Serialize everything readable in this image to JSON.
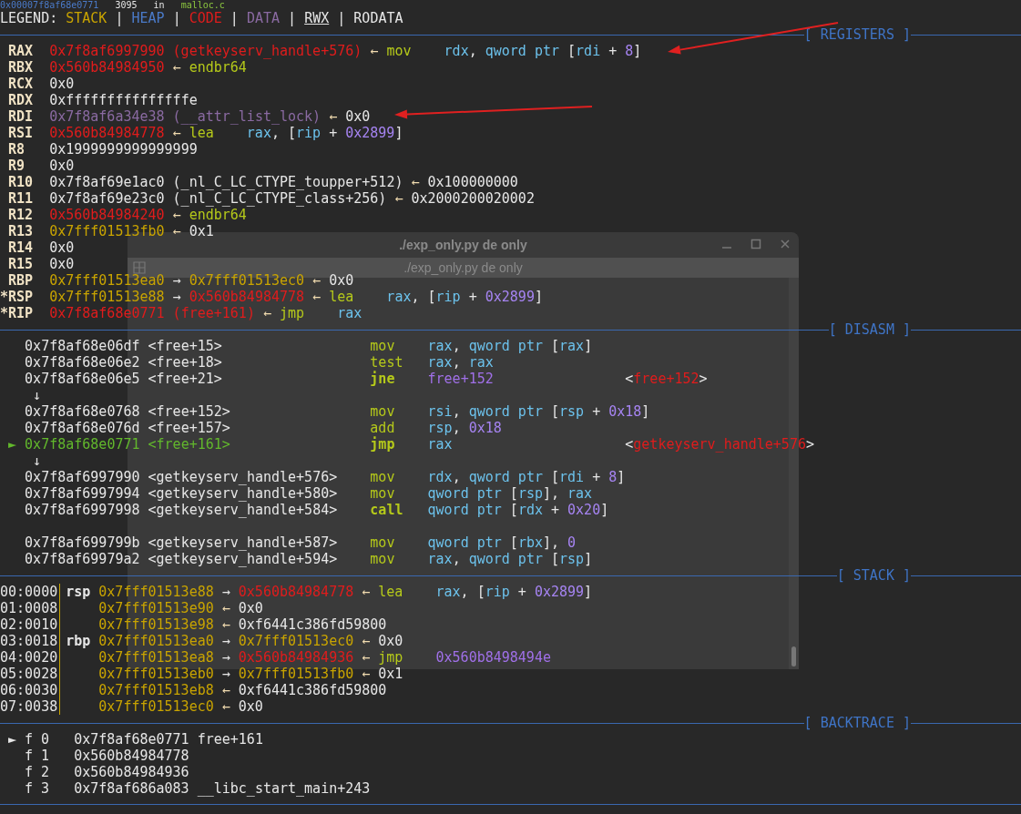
{
  "location_line": [
    {
      "text": "0x00007f8af68e0771",
      "kind": "heap"
    },
    {
      "text": "3095",
      "kind": "plain"
    },
    {
      "text": "in",
      "kind": "plain"
    },
    {
      "text": "malloc.c",
      "kind": "file"
    }
  ],
  "legend": [
    {
      "text": "LEGEND: ",
      "kind": "plain"
    },
    {
      "text": "STACK",
      "kind": "stack"
    },
    {
      "text": " | ",
      "kind": "plain"
    },
    {
      "text": "HEAP",
      "kind": "heap"
    },
    {
      "text": " | ",
      "kind": "plain"
    },
    {
      "text": "CODE",
      "kind": "code"
    },
    {
      "text": " | ",
      "kind": "plain"
    },
    {
      "text": "DATA",
      "kind": "data"
    },
    {
      "text": " | ",
      "kind": "plain"
    },
    {
      "text": "RWX",
      "kind": "rwx"
    },
    {
      "text": " | ",
      "kind": "plain"
    },
    {
      "text": "RODATA",
      "kind": "plain"
    }
  ],
  "sections": [
    {
      "kind": "registers",
      "title": "[ REGISTERS ]",
      "rows": [
        {
          "name": "RAX",
          "changed": false,
          "cells": [
            {
              "text": "0x7f8af6997990",
              "kind": "code"
            },
            {
              "text": "(getkeyserv_handle+576)",
              "kind": "code"
            },
            {
              "text": "←",
              "kind": "arrow"
            },
            {
              "mnemonic": "mov",
              "operand": [
                {
                  "text": "rdx",
                  "kind": "reg"
                },
                {
                  "text": ", ",
                  "kind": "plain"
                },
                {
                  "text": "qword ptr ",
                  "kind": "reg"
                },
                {
                  "text": "[",
                  "kind": "plain"
                },
                {
                  "text": "rdi",
                  "kind": "reg"
                },
                {
                  "text": " + ",
                  "kind": "plain"
                },
                {
                  "text": "8",
                  "kind": "num"
                },
                {
                  "text": "]",
                  "kind": "plain"
                }
              ]
            }
          ]
        },
        {
          "name": "RBX",
          "changed": false,
          "cells": [
            {
              "text": "0x560b84984950",
              "kind": "code"
            },
            {
              "text": "←",
              "kind": "arrow"
            },
            {
              "mnemonic": "endbr64"
            }
          ]
        },
        {
          "name": "RCX",
          "changed": false,
          "cells": [
            {
              "text": "0x0",
              "kind": "plain"
            }
          ]
        },
        {
          "name": "RDX",
          "changed": false,
          "cells": [
            {
              "text": "0xfffffffffffffffe",
              "kind": "plain"
            }
          ]
        },
        {
          "name": "RDI",
          "changed": false,
          "cells": [
            {
              "text": "0x7f8af6a34e38",
              "kind": "data"
            },
            {
              "text": "(__attr_list_lock)",
              "kind": "data"
            },
            {
              "text": "←",
              "kind": "arrow"
            },
            {
              "text": "0x0",
              "kind": "plain"
            }
          ]
        },
        {
          "name": "RSI",
          "changed": false,
          "cells": [
            {
              "text": "0x560b84984778",
              "kind": "code"
            },
            {
              "text": "←",
              "kind": "arrow"
            },
            {
              "mnemonic": "lea",
              "operand": [
                {
                  "text": "rax",
                  "kind": "reg"
                },
                {
                  "text": ", [",
                  "kind": "plain"
                },
                {
                  "text": "rip",
                  "kind": "reg"
                },
                {
                  "text": " + ",
                  "kind": "plain"
                },
                {
                  "text": "0x2899",
                  "kind": "num"
                },
                {
                  "text": "]",
                  "kind": "plain"
                }
              ]
            }
          ]
        },
        {
          "name": "R8",
          "changed": false,
          "cells": [
            {
              "text": "0x1999999999999999",
              "kind": "plain"
            }
          ]
        },
        {
          "name": "R9",
          "changed": false,
          "cells": [
            {
              "text": "0x0",
              "kind": "plain"
            }
          ]
        },
        {
          "name": "R10",
          "changed": false,
          "cells": [
            {
              "text": "0x7f8af69e1ac0",
              "kind": "plain"
            },
            {
              "text": "(_nl_C_LC_CTYPE_toupper+512)",
              "kind": "plain"
            },
            {
              "text": "←",
              "kind": "arrow"
            },
            {
              "text": "0x100000000",
              "kind": "plain"
            }
          ]
        },
        {
          "name": "R11",
          "changed": false,
          "cells": [
            {
              "text": "0x7f8af69e23c0",
              "kind": "plain"
            },
            {
              "text": "(_nl_C_LC_CTYPE_class+256)",
              "kind": "plain"
            },
            {
              "text": "←",
              "kind": "arrow"
            },
            {
              "text": "0x2000200020002",
              "kind": "plain"
            }
          ]
        },
        {
          "name": "R12",
          "changed": false,
          "cells": [
            {
              "text": "0x560b84984240",
              "kind": "code"
            },
            {
              "text": "←",
              "kind": "arrow"
            },
            {
              "mnemonic": "endbr64"
            }
          ]
        },
        {
          "name": "R13",
          "changed": false,
          "cells": [
            {
              "text": "0x7fff01513fb0",
              "kind": "stack"
            },
            {
              "text": "←",
              "kind": "arrow"
            },
            {
              "text": "0x1",
              "kind": "plain"
            }
          ]
        },
        {
          "name": "R14",
          "changed": false,
          "cells": [
            {
              "text": "0x0",
              "kind": "plain"
            }
          ]
        },
        {
          "name": "R15",
          "changed": false,
          "cells": [
            {
              "text": "0x0",
              "kind": "plain"
            }
          ]
        },
        {
          "name": "RBP",
          "changed": false,
          "cells": [
            {
              "text": "0x7fff01513ea0",
              "kind": "stack"
            },
            {
              "text": "→",
              "kind": "plain"
            },
            {
              "text": "0x7fff01513ec0",
              "kind": "stack"
            },
            {
              "text": "←",
              "kind": "arrow"
            },
            {
              "text": "0x0",
              "kind": "plain"
            }
          ]
        },
        {
          "name": "*RSP",
          "changed": true,
          "cells": [
            {
              "text": "0x7fff01513e88",
              "kind": "stack"
            },
            {
              "text": "→",
              "kind": "plain"
            },
            {
              "text": "0x560b84984778",
              "kind": "code"
            },
            {
              "text": "←",
              "kind": "arrow"
            },
            {
              "mnemonic": "lea",
              "operand": [
                {
                  "text": "rax",
                  "kind": "reg"
                },
                {
                  "text": ", [",
                  "kind": "plain"
                },
                {
                  "text": "rip",
                  "kind": "reg"
                },
                {
                  "text": " + ",
                  "kind": "plain"
                },
                {
                  "text": "0x2899",
                  "kind": "num"
                },
                {
                  "text": "]",
                  "kind": "plain"
                }
              ]
            }
          ]
        },
        {
          "name": "*RIP",
          "changed": true,
          "cells": [
            {
              "text": "0x7f8af68e0771",
              "kind": "code"
            },
            {
              "text": "(free+161)",
              "kind": "code"
            },
            {
              "text": "←",
              "kind": "arrow"
            },
            {
              "mnemonic": "jmp",
              "operand": [
                {
                  "text": "rax",
                  "kind": "reg"
                }
              ]
            }
          ]
        }
      ]
    },
    {
      "kind": "disasm",
      "title": "[ DISASM ]",
      "rows": [
        {
          "kind": "insn",
          "current": false,
          "address": "0x7f8af68e06df",
          "symbol": "<free+15>",
          "mnemonic": "mov",
          "branch": false,
          "operand": [
            {
              "text": "rax",
              "kind": "reg"
            },
            {
              "text": ", ",
              "kind": "plain"
            },
            {
              "text": "qword ptr ",
              "kind": "reg"
            },
            {
              "text": "[",
              "kind": "plain"
            },
            {
              "text": "rax",
              "kind": "reg"
            },
            {
              "text": "]",
              "kind": "plain"
            }
          ]
        },
        {
          "kind": "insn",
          "current": false,
          "address": "0x7f8af68e06e2",
          "symbol": "<free+18>",
          "mnemonic": "test",
          "branch": false,
          "operand": [
            {
              "text": "rax",
              "kind": "reg"
            },
            {
              "text": ", ",
              "kind": "plain"
            },
            {
              "text": "rax",
              "kind": "reg"
            }
          ]
        },
        {
          "kind": "insn",
          "current": false,
          "address": "0x7f8af68e06e5",
          "symbol": "<free+21>",
          "mnemonic": "jne",
          "branch": true,
          "operand": [
            {
              "text": "free+152",
              "kind": "sym"
            }
          ],
          "comment": [
            {
              "text": "<",
              "kind": "plain"
            },
            {
              "text": "free+152",
              "kind": "code"
            },
            {
              "text": ">",
              "kind": "plain"
            }
          ]
        },
        {
          "kind": "flow",
          "glyph": "↓"
        },
        {
          "kind": "insn",
          "current": false,
          "address": "0x7f8af68e0768",
          "symbol": "<free+152>",
          "mnemonic": "mov",
          "branch": false,
          "operand": [
            {
              "text": "rsi",
              "kind": "reg"
            },
            {
              "text": ", ",
              "kind": "plain"
            },
            {
              "text": "qword ptr ",
              "kind": "reg"
            },
            {
              "text": "[",
              "kind": "plain"
            },
            {
              "text": "rsp",
              "kind": "reg"
            },
            {
              "text": " + ",
              "kind": "plain"
            },
            {
              "text": "0x18",
              "kind": "num"
            },
            {
              "text": "]",
              "kind": "plain"
            }
          ]
        },
        {
          "kind": "insn",
          "current": false,
          "address": "0x7f8af68e076d",
          "symbol": "<free+157>",
          "mnemonic": "add",
          "branch": false,
          "operand": [
            {
              "text": "rsp",
              "kind": "reg"
            },
            {
              "text": ", ",
              "kind": "plain"
            },
            {
              "text": "0x18",
              "kind": "num"
            }
          ]
        },
        {
          "kind": "insn",
          "current": true,
          "marker": "►",
          "address": "0x7f8af68e0771",
          "symbol": "<free+161>",
          "mnemonic": "jmp",
          "branch": true,
          "operand": [
            {
              "text": "rax",
              "kind": "reg"
            }
          ],
          "comment": [
            {
              "text": "<",
              "kind": "plain"
            },
            {
              "text": "getkeyserv_handle+576",
              "kind": "code"
            },
            {
              "text": ">",
              "kind": "plain"
            }
          ]
        },
        {
          "kind": "flow",
          "glyph": "↓"
        },
        {
          "kind": "insn",
          "current": false,
          "address": "0x7f8af6997990",
          "symbol": "<getkeyserv_handle+576>",
          "mnemonic": "mov",
          "branch": false,
          "operand": [
            {
              "text": "rdx",
              "kind": "reg"
            },
            {
              "text": ", ",
              "kind": "plain"
            },
            {
              "text": "qword ptr ",
              "kind": "reg"
            },
            {
              "text": "[",
              "kind": "plain"
            },
            {
              "text": "rdi",
              "kind": "reg"
            },
            {
              "text": " + ",
              "kind": "plain"
            },
            {
              "text": "8",
              "kind": "num"
            },
            {
              "text": "]",
              "kind": "plain"
            }
          ]
        },
        {
          "kind": "insn",
          "current": false,
          "address": "0x7f8af6997994",
          "symbol": "<getkeyserv_handle+580>",
          "mnemonic": "mov",
          "branch": false,
          "operand": [
            {
              "text": "qword ptr ",
              "kind": "reg"
            },
            {
              "text": "[",
              "kind": "plain"
            },
            {
              "text": "rsp",
              "kind": "reg"
            },
            {
              "text": "], ",
              "kind": "plain"
            },
            {
              "text": "rax",
              "kind": "reg"
            }
          ]
        },
        {
          "kind": "insn",
          "current": false,
          "address": "0x7f8af6997998",
          "symbol": "<getkeyserv_handle+584>",
          "mnemonic": "call",
          "branch": true,
          "operand": [
            {
              "text": "qword ptr ",
              "kind": "reg"
            },
            {
              "text": "[",
              "kind": "plain"
            },
            {
              "text": "rdx",
              "kind": "reg"
            },
            {
              "text": " + ",
              "kind": "plain"
            },
            {
              "text": "0x20",
              "kind": "num"
            },
            {
              "text": "]",
              "kind": "plain"
            }
          ]
        },
        {
          "kind": "gap"
        },
        {
          "kind": "insn",
          "current": false,
          "address": "0x7f8af699799b",
          "symbol": "<getkeyserv_handle+587>",
          "mnemonic": "mov",
          "branch": false,
          "operand": [
            {
              "text": "qword ptr ",
              "kind": "reg"
            },
            {
              "text": "[",
              "kind": "plain"
            },
            {
              "text": "rbx",
              "kind": "reg"
            },
            {
              "text": "], ",
              "kind": "plain"
            },
            {
              "text": "0",
              "kind": "num"
            }
          ]
        },
        {
          "kind": "insn",
          "current": false,
          "address": "0x7f8af69979a2",
          "symbol": "<getkeyserv_handle+594>",
          "mnemonic": "mov",
          "branch": false,
          "operand": [
            {
              "text": "rax",
              "kind": "reg"
            },
            {
              "text": ", ",
              "kind": "plain"
            },
            {
              "text": "qword ptr ",
              "kind": "reg"
            },
            {
              "text": "[",
              "kind": "plain"
            },
            {
              "text": "rsp",
              "kind": "reg"
            },
            {
              "text": "]",
              "kind": "plain"
            }
          ]
        }
      ]
    },
    {
      "kind": "stack",
      "title": "[ STACK ]",
      "rows": [
        {
          "index": "00:0000",
          "label": "rsp",
          "cells": [
            {
              "text": "0x7fff01513e88",
              "kind": "stack"
            },
            {
              "text": "→",
              "kind": "plain"
            },
            {
              "text": "0x560b84984778",
              "kind": "code"
            },
            {
              "text": "←",
              "kind": "arrow"
            },
            {
              "mnemonic": "lea",
              "operand": [
                {
                  "text": "rax",
                  "kind": "reg"
                },
                {
                  "text": ", [",
                  "kind": "plain"
                },
                {
                  "text": "rip",
                  "kind": "reg"
                },
                {
                  "text": " + ",
                  "kind": "plain"
                },
                {
                  "text": "0x2899",
                  "kind": "num"
                },
                {
                  "text": "]",
                  "kind": "plain"
                }
              ]
            }
          ]
        },
        {
          "index": "01:0008",
          "cells": [
            {
              "text": "0x7fff01513e90",
              "kind": "stack"
            },
            {
              "text": "←",
              "kind": "arrow"
            },
            {
              "text": "0x0",
              "kind": "plain"
            }
          ]
        },
        {
          "index": "02:0010",
          "cells": [
            {
              "text": "0x7fff01513e98",
              "kind": "stack"
            },
            {
              "text": "←",
              "kind": "arrow"
            },
            {
              "text": "0xf6441c386fd59800",
              "kind": "plain"
            }
          ]
        },
        {
          "index": "03:0018",
          "label": "rbp",
          "cells": [
            {
              "text": "0x7fff01513ea0",
              "kind": "stack"
            },
            {
              "text": "→",
              "kind": "plain"
            },
            {
              "text": "0x7fff01513ec0",
              "kind": "stack"
            },
            {
              "text": "←",
              "kind": "arrow"
            },
            {
              "text": "0x0",
              "kind": "plain"
            }
          ]
        },
        {
          "index": "04:0020",
          "cells": [
            {
              "text": "0x7fff01513ea8",
              "kind": "stack"
            },
            {
              "text": "→",
              "kind": "plain"
            },
            {
              "text": "0x560b84984936",
              "kind": "code"
            },
            {
              "text": "←",
              "kind": "arrow"
            },
            {
              "mnemonic": "jmp",
              "operand": [
                {
                  "text": "0x560b8498494e",
                  "kind": "sym"
                }
              ]
            }
          ]
        },
        {
          "index": "05:0028",
          "cells": [
            {
              "text": "0x7fff01513eb0",
              "kind": "stack"
            },
            {
              "text": "→",
              "kind": "plain"
            },
            {
              "text": "0x7fff01513fb0",
              "kind": "stack"
            },
            {
              "text": "←",
              "kind": "arrow"
            },
            {
              "text": "0x1",
              "kind": "plain"
            }
          ]
        },
        {
          "index": "06:0030",
          "cells": [
            {
              "text": "0x7fff01513eb8",
              "kind": "stack"
            },
            {
              "text": "←",
              "kind": "arrow"
            },
            {
              "text": "0xf6441c386fd59800",
              "kind": "plain"
            }
          ]
        },
        {
          "index": "07:0038",
          "cells": [
            {
              "text": "0x7fff01513ec0",
              "kind": "stack"
            },
            {
              "text": "←",
              "kind": "arrow"
            },
            {
              "text": "0x0",
              "kind": "plain"
            }
          ]
        }
      ]
    },
    {
      "kind": "backtrace",
      "title": "[ BACKTRACE ]",
      "rows": [
        {
          "marker": "►",
          "frame": "f 0",
          "address": "0x7f8af68e0771",
          "symbol": "free+161"
        },
        {
          "frame": "f 1",
          "address": "0x560b84984778"
        },
        {
          "frame": "f 2",
          "address": "0x560b84984936"
        },
        {
          "frame": "f 3",
          "address": "0x7f8af686a083",
          "symbol": "__libc_start_main+243"
        }
      ]
    }
  ],
  "overlay_window": {
    "title": "./exp_only.py de only",
    "tab": "./exp_only.py de only"
  }
}
